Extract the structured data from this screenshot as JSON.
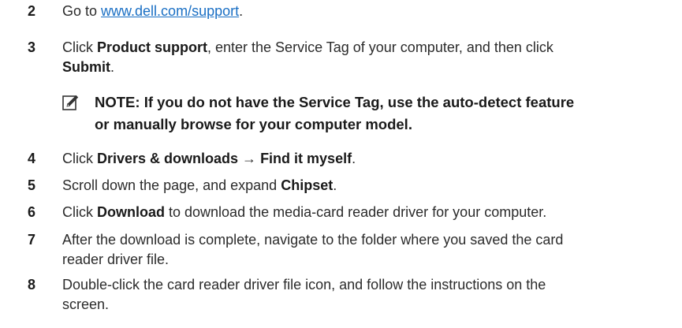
{
  "steps": [
    {
      "number": "2",
      "prefix": "Go to ",
      "link": "www.dell.com/support",
      "suffix": "."
    },
    {
      "number": "3",
      "line1_a": "Click ",
      "line1_b": "Product support",
      "line1_c": ", enter the Service Tag of your computer, and then click",
      "line2_a": "Submit",
      "line2_b": "."
    },
    {
      "number": "4",
      "a": "Click ",
      "b": "Drivers & downloads",
      "c": " → ",
      "d": "Find it myself",
      "e": "."
    },
    {
      "number": "5",
      "a": "Scroll down the page, and expand ",
      "b": "Chipset",
      "c": "."
    },
    {
      "number": "6",
      "a": "Click ",
      "b": "Download",
      "c": " to download the media-card reader driver for your computer."
    },
    {
      "number": "7",
      "line1": "After the download is complete, navigate to the folder where you saved the card",
      "line2": "reader driver file."
    },
    {
      "number": "8",
      "line1": "Double-click the card reader driver file icon, and follow the instructions on the",
      "line2": "screen."
    }
  ],
  "note": {
    "icon": "pencil-note-icon",
    "line1": "NOTE: If you do not have the Service Tag, use the auto-detect feature",
    "line2": "or manually browse for your computer model."
  }
}
